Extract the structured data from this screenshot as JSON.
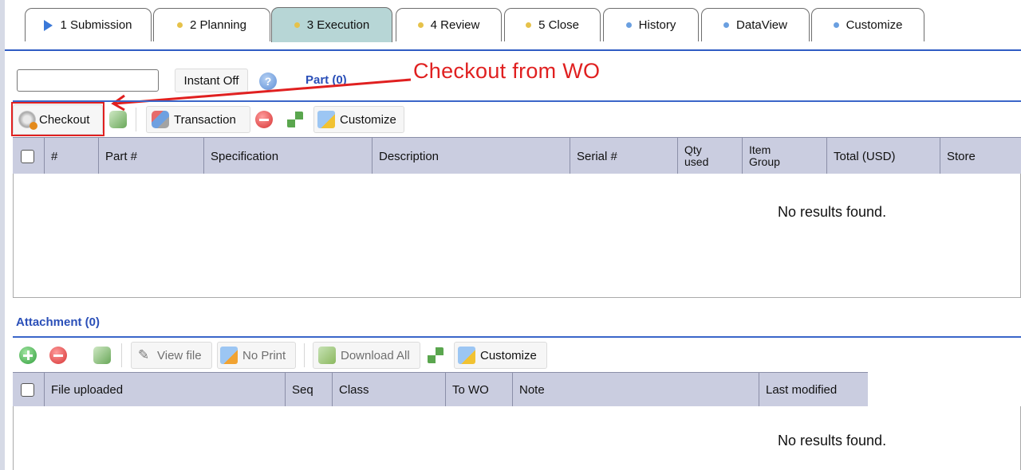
{
  "tabs": [
    {
      "label": "1 Submission",
      "icon": "play-triangle-icon",
      "active": false
    },
    {
      "label": "2 Planning",
      "icon": "dot-yellow",
      "active": false
    },
    {
      "label": "3 Execution",
      "icon": "dot-yellow",
      "active": true
    },
    {
      "label": "4 Review",
      "icon": "dot-yellow",
      "active": false
    },
    {
      "label": "5 Close",
      "icon": "dot-yellow",
      "active": false
    },
    {
      "label": "History",
      "icon": "dot-blue",
      "active": false
    },
    {
      "label": "DataView",
      "icon": "dot-blue",
      "active": false
    },
    {
      "label": "Customize",
      "icon": "dot-blue",
      "active": false
    }
  ],
  "colors": {
    "dot_yellow": "#e6c24a",
    "dot_blue": "#6a9fe0",
    "accent_blue": "#2a4fb8",
    "annotation_red": "#e02020",
    "active_tab": "#b7d6d6"
  },
  "parts": {
    "search_value": "",
    "instant_label": "Instant Off",
    "section_title": "Part (0)",
    "annotation": "Checkout from WO",
    "toolbar": {
      "checkout": "Checkout",
      "transaction": "Transaction",
      "customize": "Customize"
    },
    "columns": {
      "num": "#",
      "part": "Part #",
      "spec": "Specification",
      "desc": "Description",
      "serial": "Serial #",
      "qty_1": "Qty",
      "qty_2": "used",
      "group_1": "Item",
      "group_2": "Group",
      "total": "Total (USD)",
      "store": "Store"
    },
    "empty_text": "No results found."
  },
  "attachments": {
    "section_title": "Attachment (0)",
    "toolbar": {
      "view_file": "View file",
      "no_print": "No Print",
      "download_all": "Download All",
      "customize": "Customize"
    },
    "columns": {
      "file": "File uploaded",
      "seq": "Seq",
      "class": "Class",
      "to_wo": "To WO",
      "note": "Note",
      "last_modified": "Last modified"
    },
    "empty_text": "No results found."
  }
}
